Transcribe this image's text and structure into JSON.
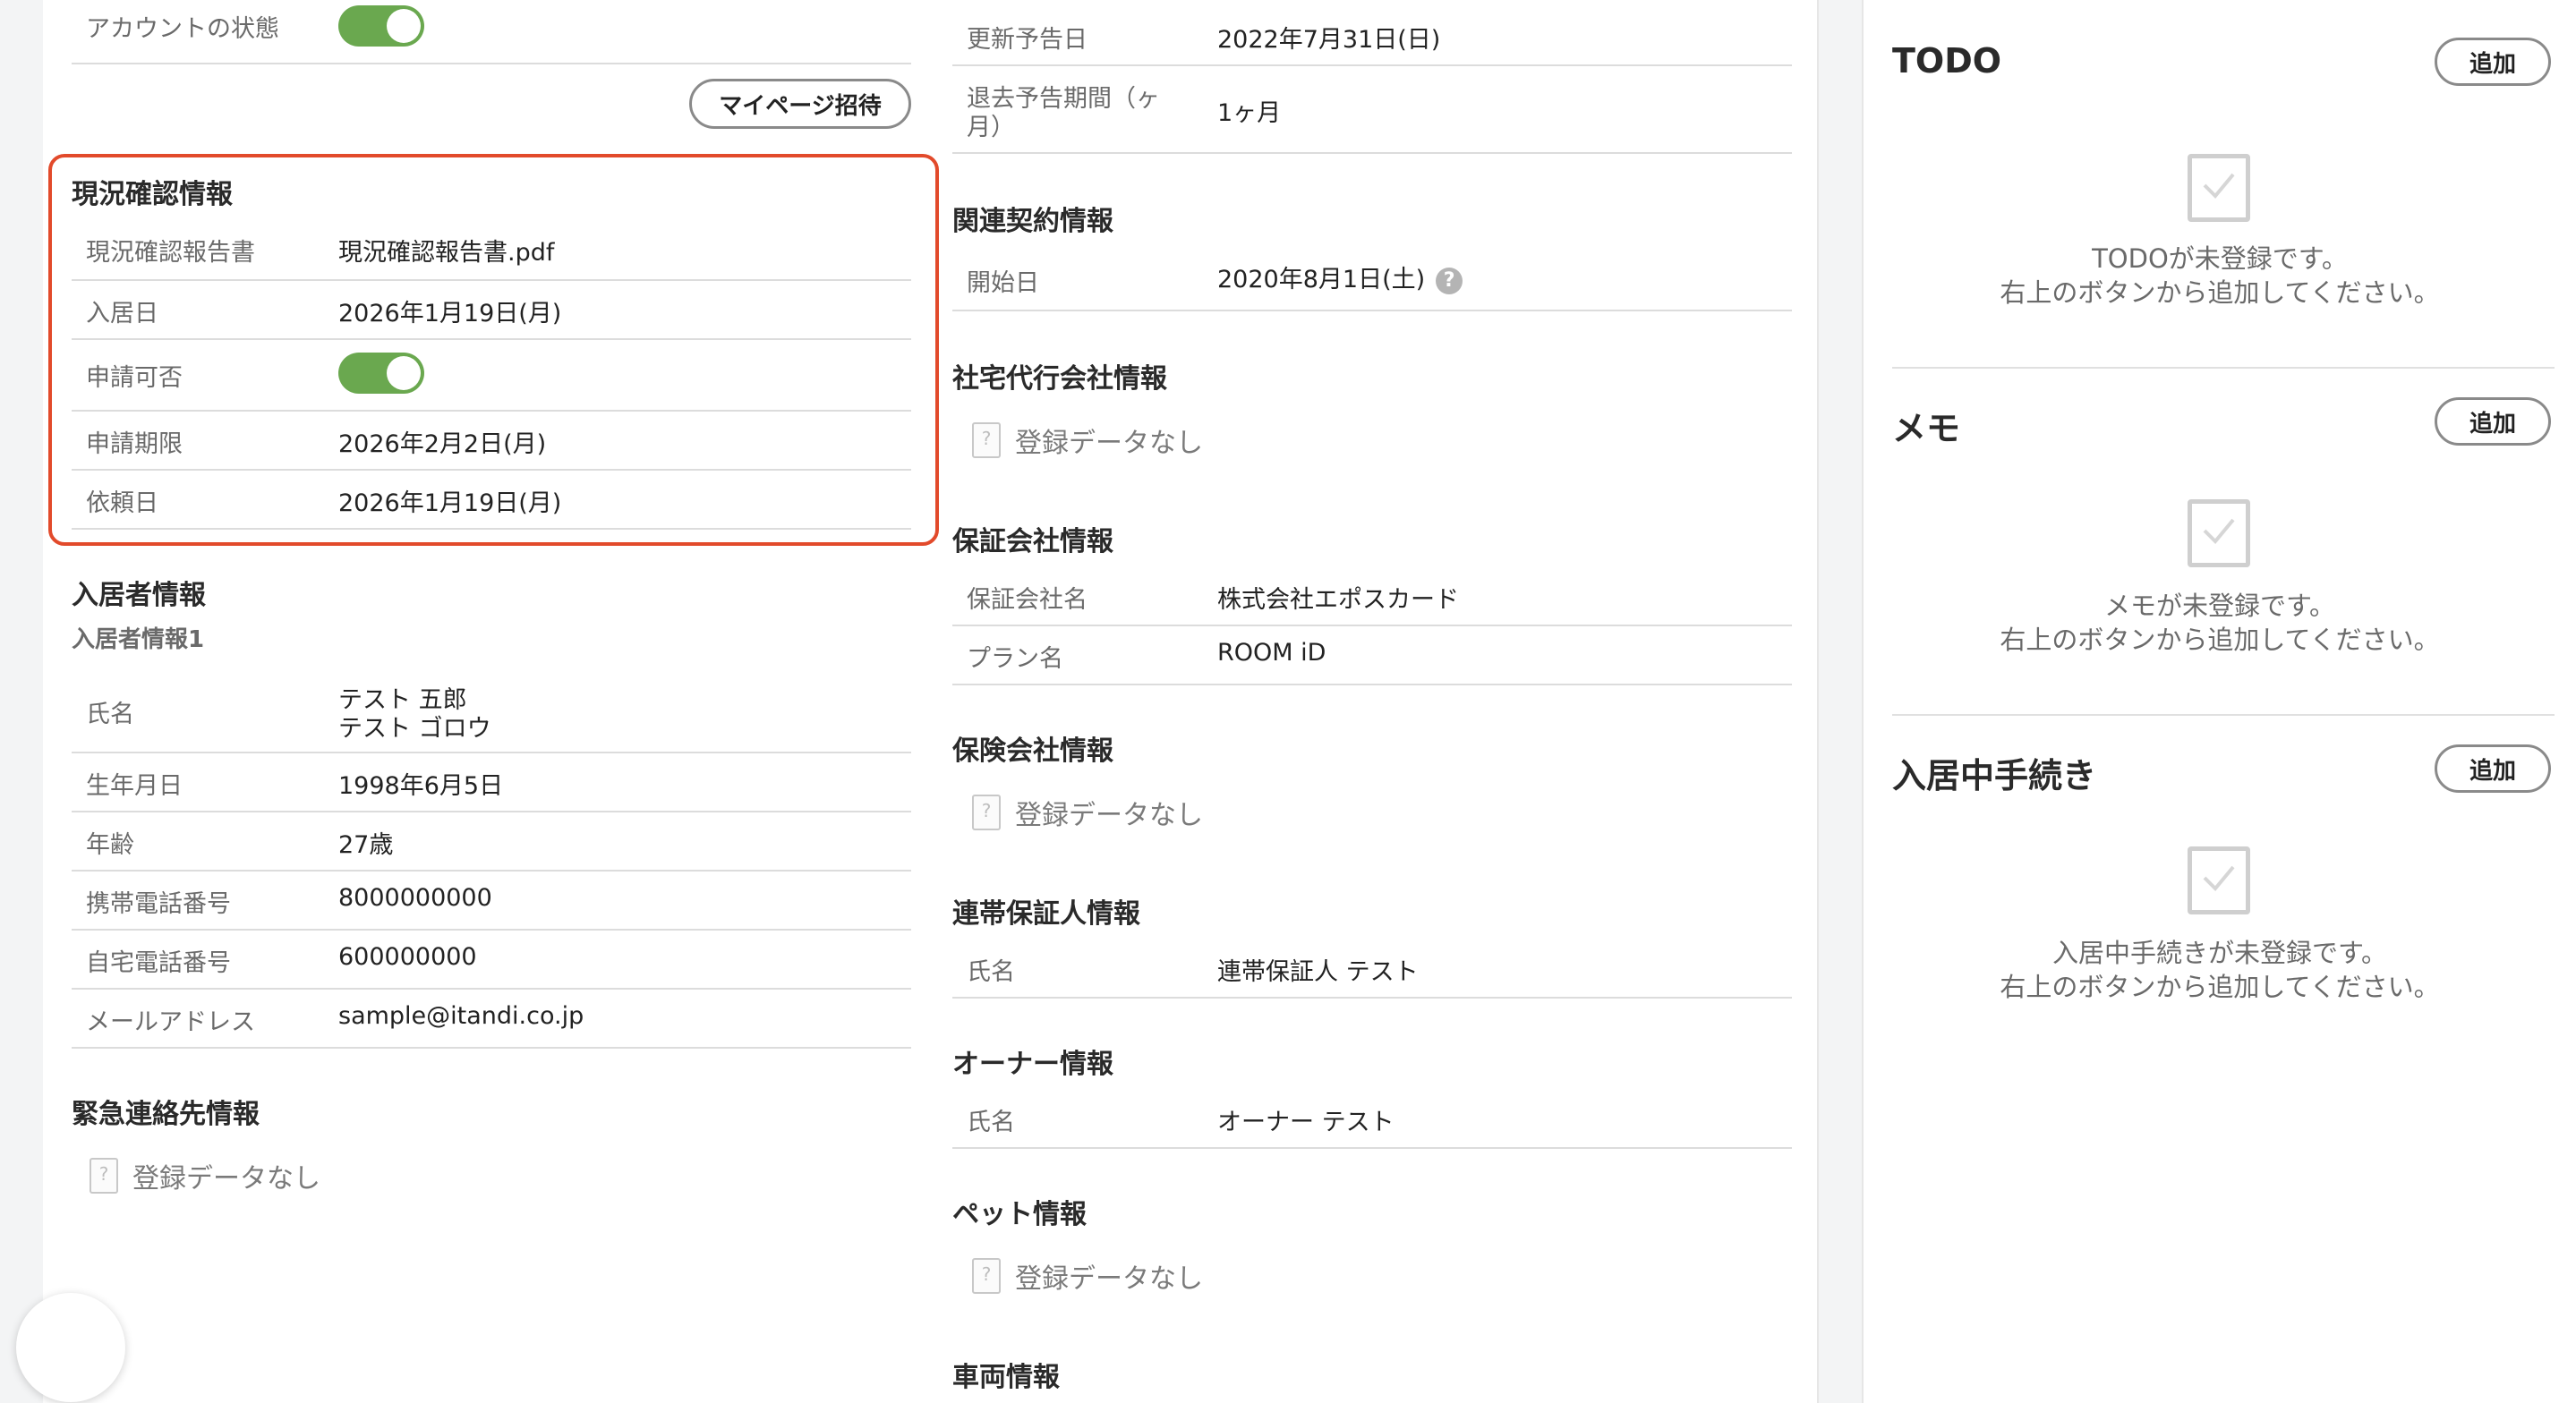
{
  "left": {
    "account_status_label": "アカウントの状態",
    "mypage_invite_button": "マイページ招待",
    "status_check": {
      "title": "現況確認情報",
      "report_label": "現況確認報告書",
      "report_link": "現況確認報告書.pdf",
      "move_in_label": "入居日",
      "move_in_value": "2026年1月19日(月)",
      "application_label": "申請可否",
      "deadline_label": "申請期限",
      "deadline_value": "2026年2月2日(月)",
      "request_label": "依頼日",
      "request_value": "2026年1月19日(月)"
    },
    "resident": {
      "title": "入居者情報",
      "subtitle": "入居者情報1",
      "name_label": "氏名",
      "name_value1": "テスト 五郎",
      "name_value2": "テスト ゴロウ",
      "birth_label": "生年月日",
      "birth_value": "1998年6月5日",
      "age_label": "年齢",
      "age_value": "27歳",
      "mobile_label": "携帯電話番号",
      "mobile_value": "8000000000",
      "home_label": "自宅電話番号",
      "home_value": "600000000",
      "email_label": "メールアドレス",
      "email_value": "sample@itandi.co.jp"
    },
    "emergency": {
      "title": "緊急連絡先情報",
      "empty": "登録データなし"
    }
  },
  "mid": {
    "renewal_label": "更新予告日",
    "renewal_value": "2022年7月31日(日)",
    "leave_notice_label1": "退去予告期間（ヶ",
    "leave_notice_label2": "月）",
    "leave_notice_value": "1ヶ月",
    "related_contract": {
      "title": "関連契約情報",
      "start_label": "開始日",
      "start_value": "2020年8月1日(土)",
      "help": "?"
    },
    "company_housing": {
      "title": "社宅代行会社情報",
      "empty": "登録データなし"
    },
    "guarantee": {
      "title": "保証会社情報",
      "company_label": "保証会社名",
      "company_value": "株式会社エポスカード",
      "plan_label": "プラン名",
      "plan_value": "ROOM iD"
    },
    "insurance": {
      "title": "保険会社情報",
      "empty": "登録データなし"
    },
    "joint_guarantor": {
      "title": "連帯保証人情報",
      "name_label": "氏名",
      "name_value": "連帯保証人 テスト"
    },
    "owner": {
      "title": "オーナー情報",
      "name_label": "氏名",
      "name_value": "オーナー テスト"
    },
    "pet": {
      "title": "ペット情報",
      "empty": "登録データなし"
    },
    "vehicle": {
      "title": "車両情報"
    }
  },
  "right": {
    "todo": {
      "title": "TODO",
      "add": "追加",
      "msg1": "TODOが未登録です。",
      "msg2": "右上のボタンから追加してください。"
    },
    "memo": {
      "title": "メモ",
      "add": "追加",
      "msg1": "メモが未登録です。",
      "msg2": "右上のボタンから追加してください。"
    },
    "procedure": {
      "title": "入居中手続き",
      "add": "追加",
      "msg1": "入居中手続きが未登録です。",
      "msg2": "右上のボタンから追加してください。"
    }
  }
}
